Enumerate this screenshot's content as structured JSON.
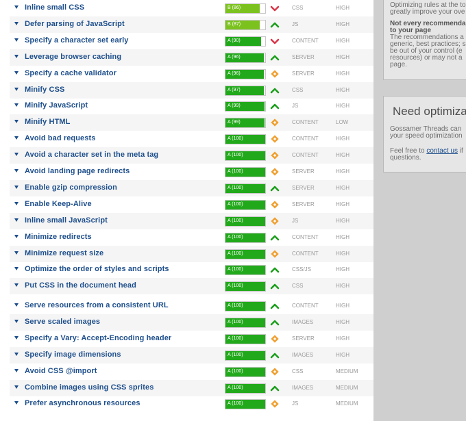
{
  "colors": {
    "grade_a": "#22a91b",
    "grade_b": "#7cc21f",
    "rule_name": "#1e4f8c",
    "trend_up": "#1a9e1a",
    "trend_down": "#d9374a",
    "trend_neutral": "#f0a030"
  },
  "rules": [
    {
      "name": "Inline small CSS",
      "grade": "B (86)",
      "score": 0.86,
      "trend": "down",
      "type": "CSS",
      "priority": "HIGH"
    },
    {
      "name": "Defer parsing of JavaScript",
      "grade": "B (87)",
      "score": 0.87,
      "trend": "up",
      "type": "JS",
      "priority": "HIGH"
    },
    {
      "name": "Specify a character set early",
      "grade": "A (90)",
      "score": 0.9,
      "trend": "down",
      "type": "CONTENT",
      "priority": "HIGH"
    },
    {
      "name": "Leverage browser caching",
      "grade": "A (96)",
      "score": 0.96,
      "trend": "up",
      "type": "SERVER",
      "priority": "HIGH"
    },
    {
      "name": "Specify a cache validator",
      "grade": "A (96)",
      "score": 0.96,
      "trend": "neutral",
      "type": "SERVER",
      "priority": "HIGH"
    },
    {
      "name": "Minify CSS",
      "grade": "A (97)",
      "score": 0.97,
      "trend": "up",
      "type": "CSS",
      "priority": "HIGH"
    },
    {
      "name": "Minify JavaScript",
      "grade": "A (99)",
      "score": 0.99,
      "trend": "up",
      "type": "JS",
      "priority": "HIGH"
    },
    {
      "name": "Minify HTML",
      "grade": "A (99)",
      "score": 0.99,
      "trend": "neutral",
      "type": "CONTENT",
      "priority": "LOW"
    },
    {
      "name": "Avoid bad requests",
      "grade": "A (100)",
      "score": 1.0,
      "trend": "neutral",
      "type": "CONTENT",
      "priority": "HIGH"
    },
    {
      "name": "Avoid a character set in the meta tag",
      "grade": "A (100)",
      "score": 1.0,
      "trend": "neutral",
      "type": "CONTENT",
      "priority": "HIGH"
    },
    {
      "name": "Avoid landing page redirects",
      "grade": "A (100)",
      "score": 1.0,
      "trend": "neutral",
      "type": "SERVER",
      "priority": "HIGH"
    },
    {
      "name": "Enable gzip compression",
      "grade": "A (100)",
      "score": 1.0,
      "trend": "up",
      "type": "SERVER",
      "priority": "HIGH"
    },
    {
      "name": "Enable Keep-Alive",
      "grade": "A (100)",
      "score": 1.0,
      "trend": "neutral",
      "type": "SERVER",
      "priority": "HIGH"
    },
    {
      "name": "Inline small JavaScript",
      "grade": "A (100)",
      "score": 1.0,
      "trend": "neutral",
      "type": "JS",
      "priority": "HIGH"
    },
    {
      "name": "Minimize redirects",
      "grade": "A (100)",
      "score": 1.0,
      "trend": "up",
      "type": "CONTENT",
      "priority": "HIGH"
    },
    {
      "name": "Minimize request size",
      "grade": "A (100)",
      "score": 1.0,
      "trend": "neutral",
      "type": "CONTENT",
      "priority": "HIGH"
    },
    {
      "name": "Optimize the order of styles and scripts",
      "grade": "A (100)",
      "score": 1.0,
      "trend": "up",
      "type": "CSS/JS",
      "priority": "HIGH"
    },
    {
      "name": "Put CSS in the document head",
      "grade": "A (100)",
      "score": 1.0,
      "trend": "up",
      "type": "CSS",
      "priority": "HIGH"
    },
    {
      "name": "Serve resources from a consistent URL",
      "grade": "A (100)",
      "score": 1.0,
      "trend": "up",
      "type": "CONTENT",
      "priority": "HIGH"
    },
    {
      "name": "Serve scaled images",
      "grade": "A (100)",
      "score": 1.0,
      "trend": "up",
      "type": "IMAGES",
      "priority": "HIGH"
    },
    {
      "name": "Specify a Vary: Accept-Encoding header",
      "grade": "A (100)",
      "score": 1.0,
      "trend": "neutral",
      "type": "SERVER",
      "priority": "HIGH"
    },
    {
      "name": "Specify image dimensions",
      "grade": "A (100)",
      "score": 1.0,
      "trend": "up",
      "type": "IMAGES",
      "priority": "HIGH"
    },
    {
      "name": "Avoid CSS @import",
      "grade": "A (100)",
      "score": 1.0,
      "trend": "neutral",
      "type": "CSS",
      "priority": "MEDIUM"
    },
    {
      "name": "Combine images using CSS sprites",
      "grade": "A (100)",
      "score": 1.0,
      "trend": "up",
      "type": "IMAGES",
      "priority": "MEDIUM"
    },
    {
      "name": "Prefer asynchronous resources",
      "grade": "A (100)",
      "score": 1.0,
      "trend": "neutral",
      "type": "JS",
      "priority": "MEDIUM"
    }
  ],
  "sidebar": {
    "card1": {
      "line1": "Optimizing rules at the to",
      "line2": "greatly improve your ove",
      "heading1": "Not every recommenda",
      "heading2": "to your page",
      "text1": "The recommendations a",
      "text2": "generic, best practices; s",
      "text3": "be out of your control (e",
      "text4": "resources) or may not a",
      "text5": "page."
    },
    "card2": {
      "title": "Need optimizatio",
      "line1": "Gossamer Threads can",
      "line2": "your speed optimization",
      "line3_prefix": "Feel free to ",
      "link": "contact us",
      "line3_suffix": " if",
      "line4": "questions."
    }
  }
}
